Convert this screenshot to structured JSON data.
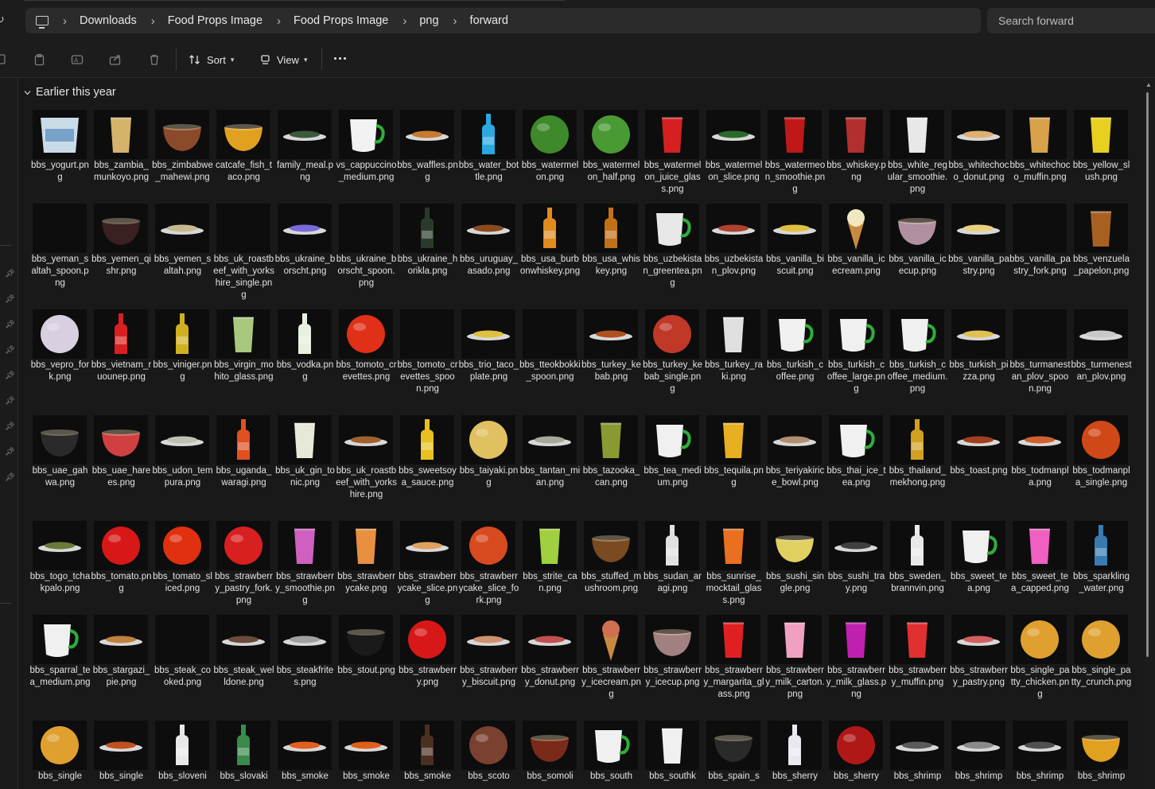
{
  "address": {
    "breadcrumbs": [
      "Downloads",
      "Food Props Image",
      "Food Props Image",
      "png",
      "forward"
    ],
    "search_placeholder": "Search forward"
  },
  "toolbar": {
    "sort_label": "Sort",
    "view_label": "View",
    "icons": [
      "copy-icon",
      "paste-icon",
      "rename-icon",
      "share-icon",
      "delete-icon",
      "sort-icon",
      "view-icon",
      "more-icon"
    ]
  },
  "section": {
    "title": "Earlier this year"
  },
  "files": [
    [
      "bbs_yogurt.png",
      "bbs_zambia_munkoyo.png",
      "bbs_zimbabwe_mahewi.png",
      "catcafe_fish_taco.png",
      "family_meal.png",
      "vs_cappuccino_medium.png",
      "bbs_waffles.png",
      "bbs_water_bottle.png",
      "bbs_watermelon.png",
      "bbs_watermelon_half.png",
      "bbs_watermelon_juice_glass.png",
      "bbs_watermelon_slice.png",
      "bbs_watermeon_smoothie.png",
      "bbs_whiskey.png",
      "bbs_white_regular_smoothie.png",
      "bbs_whitechoco_donut.png",
      "bbs_whitechoco_muffin.png",
      "bbs_yellow_slush.png"
    ],
    [
      "bbs_yeman_saltah_spoon.png",
      "bbs_yemen_qishr.png",
      "bbs_yemen_saltah.png",
      "bbs_uk_roastbeef_with_yorkshire_single.png",
      "bbs_ukraine_borscht.png",
      "bbs_ukraine_borscht_spoon.png",
      "bbs_ukraine_horikla.png",
      "bbs_uruguay_asado.png",
      "bbs_usa_burbonwhiskey.png",
      "bbs_usa_whiskey.png",
      "bbs_uzbekistan_greentea.png",
      "bbs_uzbekistan_plov.png",
      "bbs_vanilla_biscuit.png",
      "bbs_vanilla_icecream.png",
      "bbs_vanilla_icecup.png",
      "bbs_vanilla_pastry.png",
      "bbs_vanilla_pastry_fork.png",
      "bbs_venzuela_papelon.png"
    ],
    [
      "bbs_vepro_fork.png",
      "bbs_vietnam_ruounep.png",
      "bbs_viniger.png",
      "bbs_virgin_mohito_glass.png",
      "bbs_vodka.png",
      "bbs_tomoto_crevettes.png",
      "bbs_tomoto_crevettes_spoon.png",
      "bbs_trio_taco_plate.png",
      "bbs_tteokbokki_spoon.png",
      "bbs_turkey_kebab.png",
      "bbs_turkey_kebab_single.png",
      "bbs_turkey_raki.png",
      "bbs_turkish_coffee.png",
      "bbs_turkish_coffee_large.png",
      "bbs_turkish_coffee_medium.png",
      "bbs_turkish_pizza.png",
      "bbs_turmanestan_plov_spoon.png",
      "bbs_turmenestan_plov.png"
    ],
    [
      "bbs_uae_gahwa.png",
      "bbs_uae_harees.png",
      "bbs_udon_tempura.png",
      "bbs_uganda_waragi.png",
      "bbs_uk_gin_tonic.png",
      "bbs_uk_roastbeef_with_yorkshire.png",
      "bbs_sweetsoya_sauce.png",
      "bbs_taiyaki.png",
      "bbs_tantan_mian.png",
      "bbs_tazooka_can.png",
      "bbs_tea_medium.png",
      "bbs_tequila.png",
      "bbs_teriyakirice_bowl.png",
      "bbs_thai_ice_tea.png",
      "bbs_thailand_mekhong.png",
      "bbs_toast.png",
      "bbs_todmanpla.png",
      "bbs_todmanpla_single.png"
    ],
    [
      "bbs_togo_tchakpalo.png",
      "bbs_tomato.png",
      "bbs_tomato_sliced.png",
      "bbs_strawberry_pastry_fork.png",
      "bbs_strawberry_smoothie.png",
      "bbs_strawberrycake.png",
      "bbs_strawberrycake_slice.png",
      "bbs_strawberrycake_slice_fork.png",
      "bbs_strite_can.png",
      "bbs_stuffed_mushroom.png",
      "bbs_sudan_aragi.png",
      "bbs_sunrise_mocktail_glass.png",
      "bbs_sushi_single.png",
      "bbs_sushi_tray.png",
      "bbs_sweden_brannvin.png",
      "bbs_sweet_tea.png",
      "bbs_sweet_tea_capped.png",
      "bbs_sparkling_water.png"
    ],
    [
      "bbs_sparral_tea_medium.png",
      "bbs_stargazi_pie.png",
      "bbs_steak_cooked.png",
      "bbs_steak_welldone.png",
      "bbs_steakfrites.png",
      "bbs_stout.png",
      "bbs_strawberry.png",
      "bbs_strawberry_biscuit.png",
      "bbs_strawberry_donut.png",
      "bbs_strawberry_icecream.png",
      "bbs_strawberry_icecup.png",
      "bbs_strawberry_margarita_glass.png",
      "bbs_strawberry_milk_carton.png",
      "bbs_strawberry_milk_glass.png",
      "bbs_strawberry_muffin.png",
      "bbs_strawberry_pastry.png",
      "bbs_single_patty_chicken.png",
      "bbs_single_patty_crunch.png"
    ],
    [
      "bbs_single",
      "bbs_single",
      "bbs_sloveni",
      "bbs_slovaki",
      "bbs_smoke",
      "bbs_smoke",
      "bbs_smoke",
      "bbs_scoto",
      "bbs_somoli",
      "bbs_south",
      "bbs_southk",
      "bbs_spain_s",
      "bbs_sherry",
      "bbs_sherry",
      "bbs_shrimp",
      "bbs_shrimp",
      "bbs_shrimp",
      "bbs_shrimp"
    ]
  ],
  "thumbs": [
    [
      [
        "cup",
        "#c9dbe6"
      ],
      [
        "glass",
        "#d6b36a"
      ],
      [
        "bowl",
        "#8b4a2a"
      ],
      [
        "bowl",
        "#e0a020"
      ],
      [
        "plate",
        "#3a5a3a"
      ],
      [
        "mug",
        "#f2f2f2"
      ],
      [
        "plate",
        "#c87a30"
      ],
      [
        "bottle",
        "#2aa8e0"
      ],
      [
        "ball",
        "#3e8a2a"
      ],
      [
        "ball",
        "#4a9a34"
      ],
      [
        "glass",
        "#d42020"
      ],
      [
        "plate",
        "#2a6a2a"
      ],
      [
        "glass",
        "#c01818"
      ],
      [
        "glass",
        "#b03030"
      ],
      [
        "glass",
        "#e8e8e8"
      ],
      [
        "plate",
        "#e0b070"
      ],
      [
        "glass",
        "#d8a24a"
      ],
      [
        "glass",
        "#e8d020"
      ]
    ],
    [
      [
        "none",
        "#000"
      ],
      [
        "bowl",
        "#3a2020"
      ],
      [
        "plate",
        "#c8b890"
      ],
      [
        "none",
        "#000"
      ],
      [
        "plate",
        "#7a6ad8"
      ],
      [
        "none",
        "#000"
      ],
      [
        "bottle",
        "#2a3a2a"
      ],
      [
        "plate",
        "#8a4a20"
      ],
      [
        "bottle",
        "#e08a20"
      ],
      [
        "bottle",
        "#c07018"
      ],
      [
        "mug",
        "#e8e8e8"
      ],
      [
        "plate",
        "#b04030"
      ],
      [
        "plate",
        "#e0c040"
      ],
      [
        "cone",
        "#f0e8c0"
      ],
      [
        "bowl",
        "#b090a0"
      ],
      [
        "plate",
        "#e8d080"
      ],
      [
        "none",
        "#000"
      ],
      [
        "glass",
        "#a86020"
      ]
    ],
    [
      [
        "ball",
        "#d8d0e0"
      ],
      [
        "bottle",
        "#d82020"
      ],
      [
        "bottle",
        "#d0b020"
      ],
      [
        "glass",
        "#a8c880"
      ],
      [
        "bottle",
        "#e8f0e0"
      ],
      [
        "ball",
        "#e03018"
      ],
      [
        "none",
        "#000"
      ],
      [
        "plate",
        "#e0c040"
      ],
      [
        "none",
        "#000"
      ],
      [
        "plate",
        "#b05020"
      ],
      [
        "ball",
        "#c03828"
      ],
      [
        "glass",
        "#e0e0e0"
      ],
      [
        "mug",
        "#f0f0f0"
      ],
      [
        "mug",
        "#f0f0f0"
      ],
      [
        "mug",
        "#f0f0f0"
      ],
      [
        "plate",
        "#e0c050"
      ],
      [
        "none",
        "#000"
      ],
      [
        "plate",
        "#c8c8c8"
      ]
    ],
    [
      [
        "bowl",
        "#2a2a2a"
      ],
      [
        "bowl",
        "#d04040"
      ],
      [
        "plate",
        "#c0c0b0"
      ],
      [
        "bottle",
        "#e05020"
      ],
      [
        "glass",
        "#e8e8d8"
      ],
      [
        "plate",
        "#a06030"
      ],
      [
        "bottle",
        "#e8c020"
      ],
      [
        "ball",
        "#e0c060"
      ],
      [
        "plate",
        "#a8a898"
      ],
      [
        "glass",
        "#8a9a30"
      ],
      [
        "mug",
        "#f0f0f0"
      ],
      [
        "glass",
        "#e8b020"
      ],
      [
        "plate",
        "#b09070"
      ],
      [
        "mug",
        "#f0f0f0"
      ],
      [
        "bottle",
        "#d0a020"
      ],
      [
        "plate",
        "#a04020"
      ],
      [
        "plate",
        "#d06030"
      ],
      [
        "ball",
        "#d04818"
      ]
    ],
    [
      [
        "plate",
        "#6a7a3a"
      ],
      [
        "ball",
        "#d81818"
      ],
      [
        "ball",
        "#e03010"
      ],
      [
        "ball",
        "#d82020"
      ],
      [
        "glass",
        "#d060c0"
      ],
      [
        "glass",
        "#e89040"
      ],
      [
        "plate",
        "#e0a060"
      ],
      [
        "ball",
        "#d84a20"
      ],
      [
        "glass",
        "#a0d040"
      ],
      [
        "bowl",
        "#7a4a20"
      ],
      [
        "bottle",
        "#e0e0e0"
      ],
      [
        "glass",
        "#e87020"
      ],
      [
        "bowl",
        "#e0d060"
      ],
      [
        "plate",
        "#404040"
      ],
      [
        "bottle",
        "#e8e8e8"
      ],
      [
        "mug",
        "#f0f0f0"
      ],
      [
        "glass",
        "#f060c0"
      ],
      [
        "bottle",
        "#3a7ab0"
      ]
    ],
    [
      [
        "mug",
        "#f0f0f0"
      ],
      [
        "plate",
        "#c08040"
      ],
      [
        "none",
        "#000"
      ],
      [
        "plate",
        "#6a4a3a"
      ],
      [
        "plate",
        "#a0a0a0"
      ],
      [
        "bowl",
        "#1a1a1a"
      ],
      [
        "ball",
        "#d81818"
      ],
      [
        "plate",
        "#d09070"
      ],
      [
        "plate",
        "#c05050"
      ],
      [
        "cone",
        "#d07050"
      ],
      [
        "bowl",
        "#a08080"
      ],
      [
        "glass",
        "#e02020"
      ],
      [
        "glass",
        "#f0a0c0"
      ],
      [
        "glass",
        "#c020b0"
      ],
      [
        "glass",
        "#e03030"
      ],
      [
        "plate",
        "#d06060"
      ],
      [
        "ball",
        "#e0a030"
      ],
      [
        "ball",
        "#e0a030"
      ]
    ],
    [
      [
        "ball",
        "#e0a030"
      ],
      [
        "plate",
        "#c05020"
      ],
      [
        "bottle",
        "#e8e8e8"
      ],
      [
        "bottle",
        "#3a8a4a"
      ],
      [
        "plate",
        "#e06020"
      ],
      [
        "plate",
        "#e06018"
      ],
      [
        "bottle",
        "#4a3020"
      ],
      [
        "ball",
        "#7a4030"
      ],
      [
        "bowl",
        "#7a2a18"
      ],
      [
        "mug",
        "#f0f0f0"
      ],
      [
        "glass",
        "#f0f0f0"
      ],
      [
        "bowl",
        "#2a2a2a"
      ],
      [
        "bottle",
        "#e8e8f0"
      ],
      [
        "ball",
        "#b01818"
      ],
      [
        "plate",
        "#5a5a5a"
      ],
      [
        "plate",
        "#8a8a8a"
      ],
      [
        "plate",
        "#505050"
      ],
      [
        "bowl",
        "#e0a020"
      ]
    ]
  ]
}
